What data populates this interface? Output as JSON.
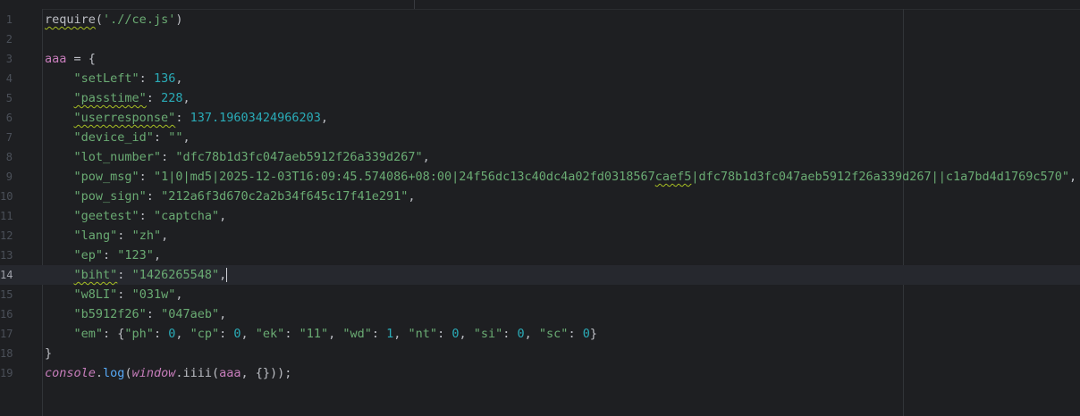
{
  "lines": [
    {
      "num": "1",
      "tokens": [
        {
          "t": "require",
          "c": "p",
          "typo": true
        },
        {
          "t": "(",
          "c": "p"
        },
        {
          "t": "'.//ce.js'",
          "c": "s"
        },
        {
          "t": ")",
          "c": "p"
        }
      ]
    },
    {
      "num": "2",
      "tokens": []
    },
    {
      "num": "3",
      "tokens": [
        {
          "t": "aaa",
          "c": "k"
        },
        {
          "t": " = {",
          "c": "p"
        }
      ]
    },
    {
      "num": "4",
      "tokens": [
        {
          "t": "    ",
          "c": "p"
        },
        {
          "t": "\"setLeft\"",
          "c": "s"
        },
        {
          "t": ": ",
          "c": "p"
        },
        {
          "t": "136",
          "c": "n"
        },
        {
          "t": ",",
          "c": "p"
        }
      ]
    },
    {
      "num": "5",
      "tokens": [
        {
          "t": "    ",
          "c": "p"
        },
        {
          "t": "\"passtime\"",
          "c": "s",
          "typo": true
        },
        {
          "t": ": ",
          "c": "p"
        },
        {
          "t": "228",
          "c": "n"
        },
        {
          "t": ",",
          "c": "p"
        }
      ]
    },
    {
      "num": "6",
      "tokens": [
        {
          "t": "    ",
          "c": "p"
        },
        {
          "t": "\"userresponse\"",
          "c": "s",
          "typo": true
        },
        {
          "t": ": ",
          "c": "p"
        },
        {
          "t": "137.19603424966203",
          "c": "n"
        },
        {
          "t": ",",
          "c": "p"
        }
      ]
    },
    {
      "num": "7",
      "tokens": [
        {
          "t": "    ",
          "c": "p"
        },
        {
          "t": "\"device_id\"",
          "c": "s"
        },
        {
          "t": ": ",
          "c": "p"
        },
        {
          "t": "\"\"",
          "c": "s"
        },
        {
          "t": ",",
          "c": "p"
        }
      ]
    },
    {
      "num": "8",
      "tokens": [
        {
          "t": "    ",
          "c": "p"
        },
        {
          "t": "\"lot_number\"",
          "c": "s"
        },
        {
          "t": ": ",
          "c": "p"
        },
        {
          "t": "\"dfc78b1d3fc047aeb5912f26a339d267\"",
          "c": "s"
        },
        {
          "t": ",",
          "c": "p"
        }
      ]
    },
    {
      "num": "9",
      "tokens": [
        {
          "t": "    ",
          "c": "p"
        },
        {
          "t": "\"pow_msg\"",
          "c": "s"
        },
        {
          "t": ": ",
          "c": "p"
        },
        {
          "t": "\"1|0|md5|2025-12-03T16:09:45.574086+08:00|24f56dc13c40dc4a02fd0318567",
          "c": "s"
        },
        {
          "t": "caef5",
          "c": "s",
          "typo": true
        },
        {
          "t": "|dfc78b1d3fc047aeb5912f26a339d267||c1a7bd4d1769c570\"",
          "c": "s"
        },
        {
          "t": ",",
          "c": "p"
        }
      ]
    },
    {
      "num": "10",
      "tokens": [
        {
          "t": "    ",
          "c": "p"
        },
        {
          "t": "\"pow_sign\"",
          "c": "s"
        },
        {
          "t": ": ",
          "c": "p"
        },
        {
          "t": "\"212a6f3d670c2a2b34f645c17f41e291\"",
          "c": "s"
        },
        {
          "t": ",",
          "c": "p"
        }
      ]
    },
    {
      "num": "11",
      "tokens": [
        {
          "t": "    ",
          "c": "p"
        },
        {
          "t": "\"geetest\"",
          "c": "s"
        },
        {
          "t": ": ",
          "c": "p"
        },
        {
          "t": "\"captcha\"",
          "c": "s"
        },
        {
          "t": ",",
          "c": "p"
        }
      ]
    },
    {
      "num": "12",
      "tokens": [
        {
          "t": "    ",
          "c": "p"
        },
        {
          "t": "\"lang\"",
          "c": "s"
        },
        {
          "t": ": ",
          "c": "p"
        },
        {
          "t": "\"zh\"",
          "c": "s"
        },
        {
          "t": ",",
          "c": "p"
        }
      ]
    },
    {
      "num": "13",
      "tokens": [
        {
          "t": "    ",
          "c": "p"
        },
        {
          "t": "\"ep\"",
          "c": "s"
        },
        {
          "t": ": ",
          "c": "p"
        },
        {
          "t": "\"123\"",
          "c": "s"
        },
        {
          "t": ",",
          "c": "p"
        }
      ]
    },
    {
      "num": "14",
      "current": true,
      "tokens": [
        {
          "t": "    ",
          "c": "p"
        },
        {
          "t": "\"biht\"",
          "c": "s",
          "typo": true
        },
        {
          "t": ": ",
          "c": "p"
        },
        {
          "t": "\"1426265548\"",
          "c": "s"
        },
        {
          "t": ",",
          "c": "p"
        },
        {
          "caret": true
        }
      ]
    },
    {
      "num": "15",
      "tokens": [
        {
          "t": "    ",
          "c": "p"
        },
        {
          "t": "\"w8LI\"",
          "c": "s"
        },
        {
          "t": ": ",
          "c": "p"
        },
        {
          "t": "\"031w\"",
          "c": "s"
        },
        {
          "t": ",",
          "c": "p"
        }
      ]
    },
    {
      "num": "16",
      "tokens": [
        {
          "t": "    ",
          "c": "p"
        },
        {
          "t": "\"b5912f26\"",
          "c": "s"
        },
        {
          "t": ": ",
          "c": "p"
        },
        {
          "t": "\"047aeb\"",
          "c": "s"
        },
        {
          "t": ",",
          "c": "p"
        }
      ]
    },
    {
      "num": "17",
      "tokens": [
        {
          "t": "    ",
          "c": "p"
        },
        {
          "t": "\"em\"",
          "c": "s"
        },
        {
          "t": ": {",
          "c": "p"
        },
        {
          "t": "\"ph\"",
          "c": "s"
        },
        {
          "t": ": ",
          "c": "p"
        },
        {
          "t": "0",
          "c": "n"
        },
        {
          "t": ", ",
          "c": "p"
        },
        {
          "t": "\"cp\"",
          "c": "s"
        },
        {
          "t": ": ",
          "c": "p"
        },
        {
          "t": "0",
          "c": "n"
        },
        {
          "t": ", ",
          "c": "p"
        },
        {
          "t": "\"ek\"",
          "c": "s"
        },
        {
          "t": ": ",
          "c": "p"
        },
        {
          "t": "\"11\"",
          "c": "s"
        },
        {
          "t": ", ",
          "c": "p"
        },
        {
          "t": "\"wd\"",
          "c": "s"
        },
        {
          "t": ": ",
          "c": "p"
        },
        {
          "t": "1",
          "c": "n"
        },
        {
          "t": ", ",
          "c": "p"
        },
        {
          "t": "\"nt\"",
          "c": "s"
        },
        {
          "t": ": ",
          "c": "p"
        },
        {
          "t": "0",
          "c": "n"
        },
        {
          "t": ", ",
          "c": "p"
        },
        {
          "t": "\"si\"",
          "c": "s"
        },
        {
          "t": ": ",
          "c": "p"
        },
        {
          "t": "0",
          "c": "n"
        },
        {
          "t": ", ",
          "c": "p"
        },
        {
          "t": "\"sc\"",
          "c": "s"
        },
        {
          "t": ": ",
          "c": "p"
        },
        {
          "t": "0",
          "c": "n"
        },
        {
          "t": "}",
          "c": "p"
        }
      ]
    },
    {
      "num": "18",
      "tokens": [
        {
          "t": "}",
          "c": "p"
        }
      ]
    },
    {
      "num": "19",
      "tokens": [
        {
          "t": "console",
          "c": "it"
        },
        {
          "t": ".",
          "c": "p"
        },
        {
          "t": "log",
          "c": "fn"
        },
        {
          "t": "(",
          "c": "p"
        },
        {
          "t": "window",
          "c": "it"
        },
        {
          "t": ".iiii(",
          "c": "p"
        },
        {
          "t": "aaa",
          "c": "k"
        },
        {
          "t": ", {}));",
          "c": "p"
        }
      ]
    }
  ]
}
